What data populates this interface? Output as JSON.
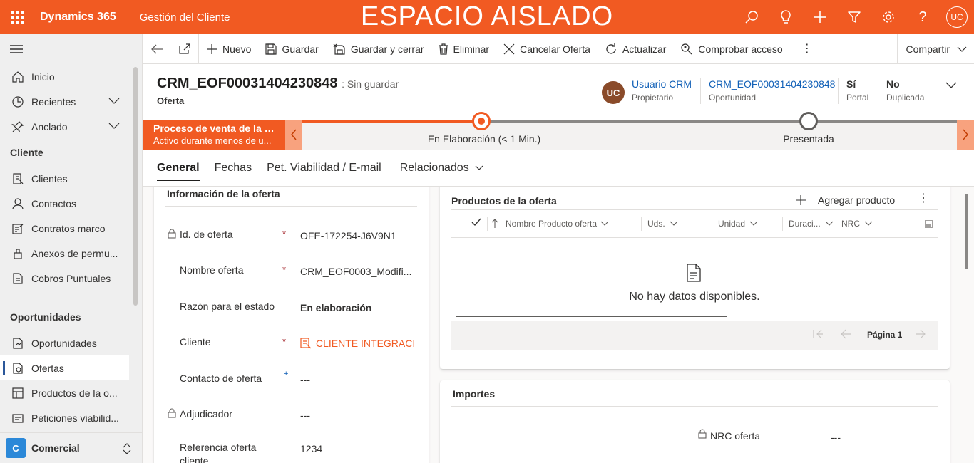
{
  "topbar": {
    "brand": "Dynamics 365",
    "app_name": "Gestión del Cliente",
    "sandbox_banner": "ESPACIO AISLADO",
    "user_initials": "UC",
    "icons": [
      "search-icon",
      "lightbulb-icon",
      "plus-icon",
      "filter-icon",
      "settings-icon",
      "help-icon"
    ]
  },
  "sidebar": {
    "top_items": [
      {
        "label": "Inicio",
        "icon": "home-icon"
      },
      {
        "label": "Recientes",
        "icon": "clock-icon"
      },
      {
        "label": "Anclado",
        "icon": "pin-icon"
      }
    ],
    "groups": [
      {
        "title": "Cliente",
        "items": [
          {
            "label": "Clientes",
            "icon": "account-icon"
          },
          {
            "label": "Contactos",
            "icon": "person-icon"
          },
          {
            "label": "Contratos marco",
            "icon": "contract-icon"
          },
          {
            "label": "Anexos de permu...",
            "icon": "annex-icon"
          },
          {
            "label": "Cobros Puntuales",
            "icon": "document-icon"
          }
        ]
      },
      {
        "title": "Oportunidades",
        "items": [
          {
            "label": "Oportunidades",
            "icon": "opportunity-icon"
          },
          {
            "label": "Ofertas",
            "icon": "quote-icon",
            "active": true
          },
          {
            "label": "Productos de la o...",
            "icon": "product-icon"
          },
          {
            "label": "Peticiones viabilid...",
            "icon": "request-icon"
          }
        ]
      }
    ],
    "area": {
      "badge": "C",
      "label": "Comercial"
    }
  },
  "commandbar": {
    "new": "Nuevo",
    "save": "Guardar",
    "save_close": "Guardar y cerrar",
    "delete": "Eliminar",
    "cancel_offer": "Cancelar Oferta",
    "refresh": "Actualizar",
    "check_access": "Comprobar acceso",
    "share": "Compartir"
  },
  "header": {
    "title": "CRM_EOF00031404230848",
    "status": ": Sin guardar",
    "entity": "Oferta",
    "owner_initials": "UC",
    "owner_name": "Usuario CRM",
    "owner_label": "Propietario",
    "opportunity_value": "CRM_EOF00031404230848",
    "opportunity_label": "Oportunidad",
    "portal_value": "Sí",
    "portal_label": "Portal",
    "duplicate_value": "No",
    "duplicate_label": "Duplicada"
  },
  "bpf": {
    "process_name": "Proceso de venta de la o...",
    "process_status": "Activo durante menos de u...",
    "stages": [
      {
        "label": "En Elaboración  (< 1 Min.)",
        "state": "current"
      },
      {
        "label": "Presentada",
        "state": "next"
      }
    ]
  },
  "tabs": [
    "General",
    "Fechas",
    "Pet. Viabilidad / E-mail",
    "Relacionados"
  ],
  "offer_info": {
    "title": "Información de la oferta",
    "fields": [
      {
        "label": "Id. de oferta",
        "value": "OFE-172254-J6V9N1",
        "locked": true,
        "required": true
      },
      {
        "label": "Nombre oferta",
        "value": "CRM_EOF0003_Modifi...",
        "required": true
      },
      {
        "label": "Razón para el estado",
        "value": "En elaboración"
      },
      {
        "label": "Cliente",
        "value": "CLIENTE INTEGRACI...",
        "required": true
      },
      {
        "label": "Contacto de oferta",
        "value": "---",
        "recommended": true
      },
      {
        "label": "Adjudicador",
        "value": "---",
        "locked": true
      },
      {
        "label": "Referencia oferta cliente",
        "value": "1234"
      }
    ]
  },
  "products": {
    "title": "Productos de la oferta",
    "add_label": "Agregar producto",
    "columns": [
      "Nombre Producto oferta",
      "Uds.",
      "Unidad",
      "Duraci...",
      "NRC"
    ],
    "empty_text": "No hay datos disponibles.",
    "page_label": "Página 1"
  },
  "amounts": {
    "title": "Importes",
    "nrc_label": "NRC oferta",
    "nrc_value": "---"
  }
}
